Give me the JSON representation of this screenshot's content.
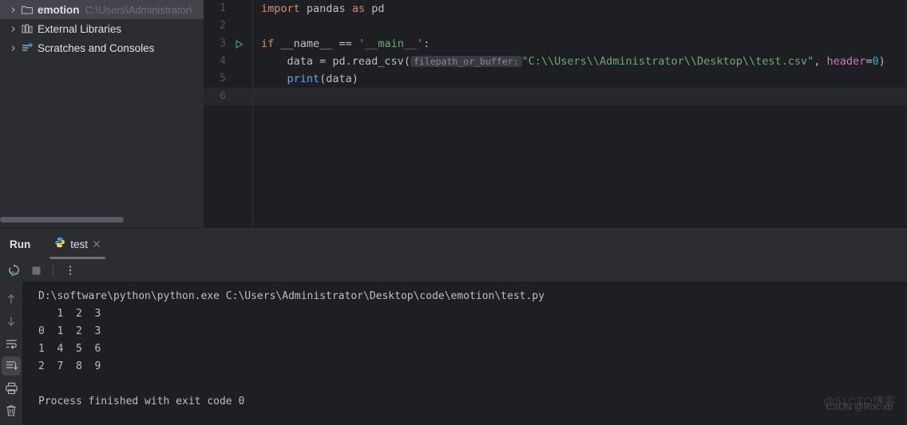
{
  "project_tree": {
    "items": [
      {
        "label": "emotion",
        "path": "C:\\Users\\Administrator\\",
        "icon": "folder-icon",
        "bold": true,
        "selected": true
      },
      {
        "label": "External Libraries",
        "path": "",
        "icon": "library-icon",
        "bold": false,
        "selected": false
      },
      {
        "label": "Scratches and Consoles",
        "path": "",
        "icon": "scratches-icon",
        "bold": false,
        "selected": false
      }
    ]
  },
  "editor": {
    "lines": [
      {
        "num": "1",
        "has_run_marker": false,
        "current": false
      },
      {
        "num": "2",
        "has_run_marker": false,
        "current": false
      },
      {
        "num": "3",
        "has_run_marker": true,
        "current": false
      },
      {
        "num": "4",
        "has_run_marker": false,
        "current": false
      },
      {
        "num": "5",
        "has_run_marker": false,
        "current": false
      },
      {
        "num": "6",
        "has_run_marker": false,
        "current": true
      }
    ],
    "code": {
      "l1_import": "import",
      "l1_module": " pandas ",
      "l1_as": "as",
      "l1_alias": " pd",
      "l3_if": "if",
      "l3_name": " __name__ == ",
      "l3_str": "'__main__'",
      "l3_colon": ":",
      "l4_indent": "    ",
      "l4_data": "data = pd.read_csv(",
      "l4_hint": "filepath_or_buffer:",
      "l4_str": "\"C:\\\\Users\\\\Administrator\\\\Desktop\\\\test.csv\"",
      "l4_comma": ", ",
      "l4_kwarg": "header",
      "l4_eq": "=",
      "l4_num": "0",
      "l4_close": ")",
      "l5_indent": "    ",
      "l5_print": "print",
      "l5_args": "(data)"
    }
  },
  "run_panel": {
    "title": "Run",
    "tab": {
      "label": "test",
      "icon": "python-icon",
      "close_icon": "close-icon"
    },
    "toolbar": [
      {
        "name": "rerun-button",
        "icon": "rerun-icon"
      },
      {
        "name": "stop-button",
        "icon": "stop-icon"
      },
      {
        "name": "more-options-button",
        "icon": "vertical-dots-icon"
      }
    ],
    "side_rail": [
      {
        "name": "scroll-up-button",
        "icon": "arrow-up-icon",
        "active": false
      },
      {
        "name": "scroll-down-button",
        "icon": "arrow-down-icon",
        "active": false
      },
      {
        "name": "soft-wrap-button",
        "icon": "soft-wrap-icon",
        "active": false
      },
      {
        "name": "scroll-to-end-button",
        "icon": "scroll-to-end-icon",
        "active": true
      },
      {
        "name": "print-button",
        "icon": "printer-icon",
        "active": false
      },
      {
        "name": "clear-all-button",
        "icon": "trash-icon",
        "active": false
      }
    ],
    "console_output": [
      "D:\\software\\python\\python.exe C:\\Users\\Administrator\\Desktop\\code\\emotion\\test.py",
      "   1  2  3",
      "0  1  2  3",
      "1  4  5  6",
      "2  7  8  9",
      "",
      "Process finished with exit code 0"
    ]
  },
  "watermark": {
    "line1": "@51CTO博客",
    "line2": "CSDN @Roc·xb"
  },
  "colors": {
    "keyword": "#cf8e6d",
    "string": "#6aab73",
    "number": "#2aacb8",
    "function": "#56a8f5",
    "named_arg": "#c77dbb",
    "editor_bg": "#1e1f22",
    "panel_bg": "#2b2d30"
  }
}
